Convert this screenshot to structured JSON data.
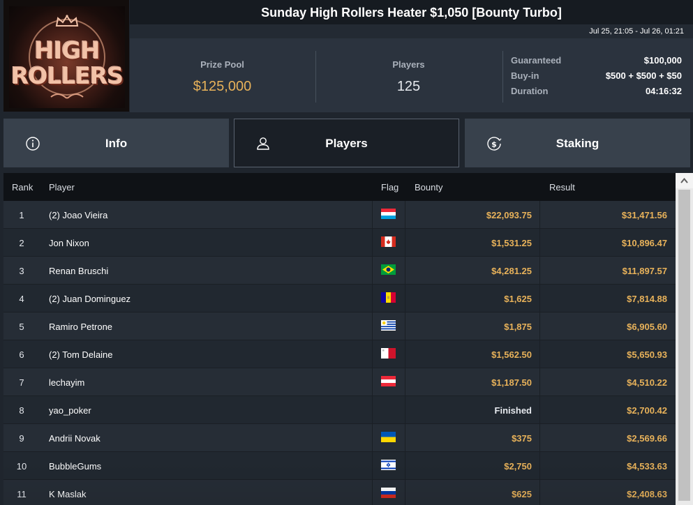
{
  "header": {
    "logo_text": [
      "HIGH",
      "ROLLERS"
    ],
    "title": "Sunday High Rollers Heater $1,050 [Bounty Turbo]",
    "dates": "Jul 25, 21:05 - Jul 26, 01:21"
  },
  "stats": {
    "prize_pool_label": "Prize Pool",
    "prize_pool_value": "$125,000",
    "players_label": "Players",
    "players_value": "125",
    "details": [
      {
        "key": "Guaranteed",
        "value": "$100,000"
      },
      {
        "key": "Buy-in",
        "value": "$500 + $500 + $50"
      },
      {
        "key": "Duration",
        "value": "04:16:32"
      }
    ]
  },
  "tabs": [
    {
      "label": "Info",
      "icon": "info-icon"
    },
    {
      "label": "Players",
      "icon": "user-icon"
    },
    {
      "label": "Staking",
      "icon": "dollar-coin-icon"
    }
  ],
  "table": {
    "columns": {
      "rank": "Rank",
      "player": "Player",
      "flag": "Flag",
      "bounty": "Bounty",
      "result": "Result"
    },
    "rows": [
      {
        "rank": "1",
        "player": "(2) Joao Vieira",
        "flag": "luxembourg",
        "bounty": "$22,093.75",
        "result": "$31,471.56"
      },
      {
        "rank": "2",
        "player": "Jon Nixon",
        "flag": "canada",
        "bounty": "$1,531.25",
        "result": "$10,896.47"
      },
      {
        "rank": "3",
        "player": "Renan Bruschi",
        "flag": "brazil",
        "bounty": "$4,281.25",
        "result": "$11,897.57"
      },
      {
        "rank": "4",
        "player": "(2) Juan Dominguez",
        "flag": "andorra",
        "bounty": "$1,625",
        "result": "$7,814.88"
      },
      {
        "rank": "5",
        "player": "Ramiro Petrone",
        "flag": "uruguay",
        "bounty": "$1,875",
        "result": "$6,905.60"
      },
      {
        "rank": "6",
        "player": "(2) Tom Delaine",
        "flag": "malta",
        "bounty": "$1,562.50",
        "result": "$5,650.93"
      },
      {
        "rank": "7",
        "player": "lechayim",
        "flag": "austria",
        "bounty": "$1,187.50",
        "result": "$4,510.22"
      },
      {
        "rank": "8",
        "player": "yao_poker",
        "flag": "",
        "bounty": "Finished",
        "result": "$2,700.42"
      },
      {
        "rank": "9",
        "player": "Andrii Novak",
        "flag": "ukraine",
        "bounty": "$375",
        "result": "$2,569.66"
      },
      {
        "rank": "10",
        "player": "BubbleGums",
        "flag": "israel",
        "bounty": "$2,750",
        "result": "$4,533.63"
      },
      {
        "rank": "11",
        "player": "K Maslak",
        "flag": "russia",
        "bounty": "$625",
        "result": "$2,408.63"
      }
    ]
  },
  "colors": {
    "accent_gold": "#e8b25a",
    "panel": "#2b333e",
    "title_bg": "#161b21"
  }
}
